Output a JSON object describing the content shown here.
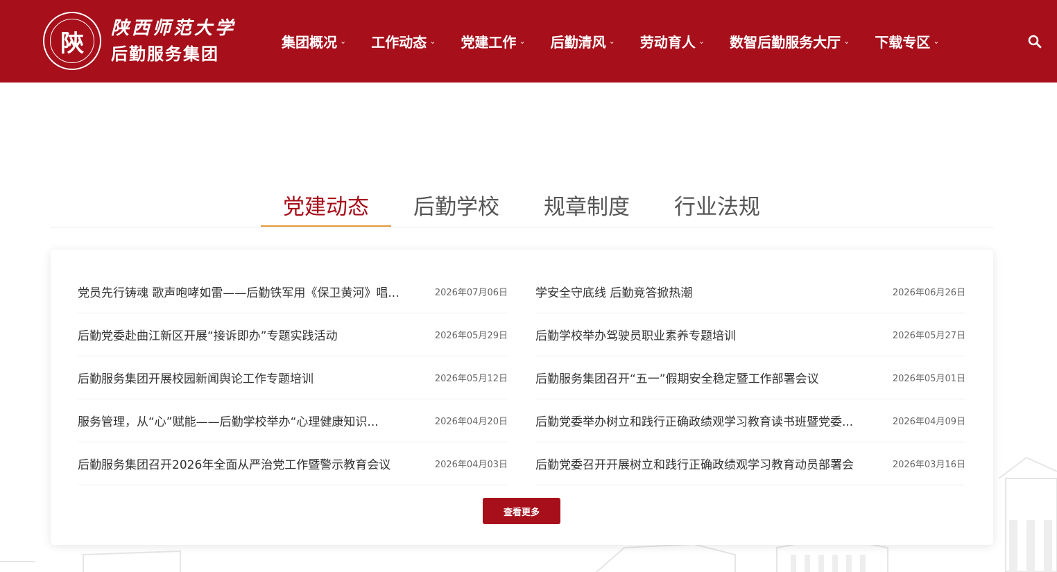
{
  "header": {
    "logo_seal_char": "陝",
    "logo_line1": "陕西师范大学",
    "logo_line2": "后勤服务集团",
    "brand_color": "#a70f1b"
  },
  "nav": {
    "items": [
      {
        "label": "集团概况"
      },
      {
        "label": "工作动态"
      },
      {
        "label": "党建工作"
      },
      {
        "label": "后勤清风"
      },
      {
        "label": "劳动育人"
      },
      {
        "label": "数智后勤服务大厅"
      },
      {
        "label": "下载专区"
      }
    ],
    "chevron": "⌄",
    "search_icon": "search-icon"
  },
  "tabs": {
    "items": [
      {
        "label": "党建动态"
      },
      {
        "label": "后勤学校"
      },
      {
        "label": "规章制度"
      },
      {
        "label": "行业法规"
      }
    ],
    "active_index": 0,
    "accent_underline": "#e59a3a"
  },
  "news": {
    "left": [
      {
        "title": "党员先行铸魂 歌声咆哮如雷——后勤铁军用《保卫黄河》唱...",
        "date": "2026年07月06日"
      },
      {
        "title": "后勤党委赴曲江新区开展“接诉即办”专题实践活动",
        "date": "2026年05月29日"
      },
      {
        "title": "后勤服务集团开展校园新闻舆论工作专题培训",
        "date": "2026年05月12日"
      },
      {
        "title": "服务管理，从“心”赋能——后勤学校举办“心理健康知识...",
        "date": "2026年04月20日"
      },
      {
        "title": "后勤服务集团召开2026年全面从严治党工作暨警示教育会议",
        "date": "2026年04月03日"
      }
    ],
    "right": [
      {
        "title": "学安全守底线 后勤竞答掀热潮",
        "date": "2026年06月26日"
      },
      {
        "title": "后勤学校举办驾驶员职业素养专题培训",
        "date": "2026年05月27日"
      },
      {
        "title": "后勤服务集团召开“五一”假期安全稳定暨工作部署会议",
        "date": "2026年05月01日"
      },
      {
        "title": "后勤党委举办树立和践行正确政绩观学习教育读书班暨党委...",
        "date": "2026年04月09日"
      },
      {
        "title": "后勤党委召开开展树立和践行正确政绩观学习教育动员部署会",
        "date": "2026年03月16日"
      }
    ],
    "more_label": "查看更多"
  }
}
